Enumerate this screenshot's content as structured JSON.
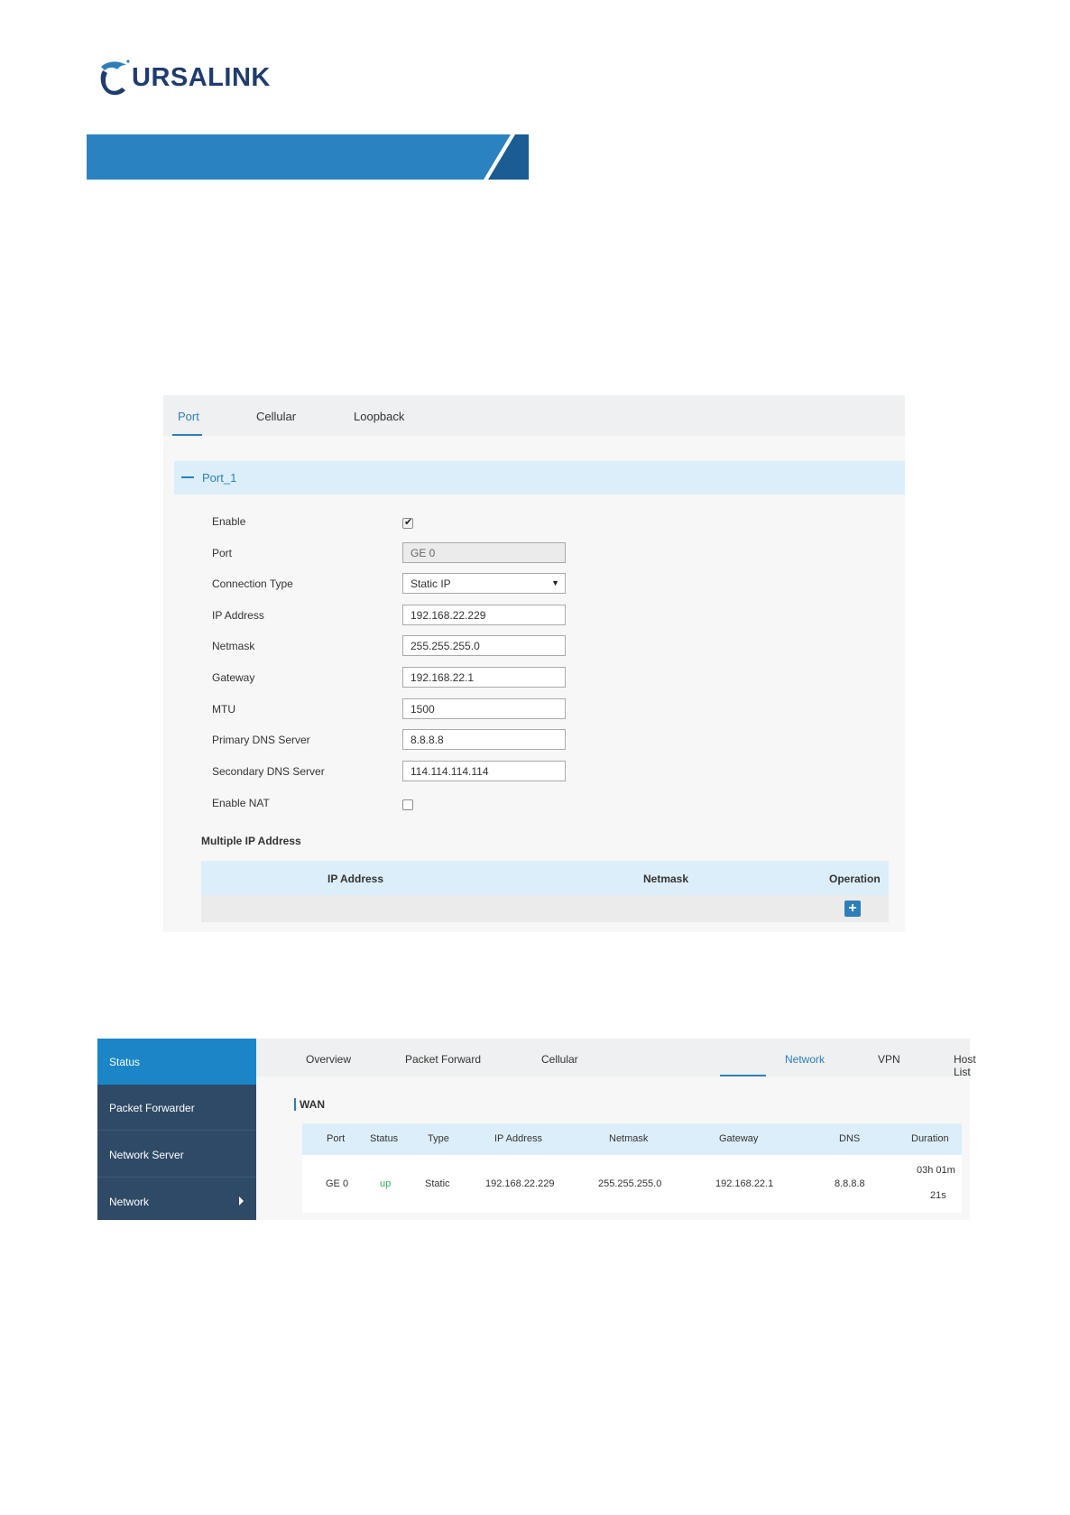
{
  "logo": {
    "text": "URSALINK"
  },
  "colors": {
    "brand": "#2d7fb9",
    "sidebar": "#2e4a66",
    "sidebar_active": "#1a86c8",
    "header_band": "#dceef9",
    "status_up": "#2fa84f"
  },
  "port_config": {
    "tabs": [
      "Port",
      "Cellular",
      "Loopback"
    ],
    "active_tab": "Port",
    "section_title": "Port_1",
    "fields": {
      "enable": {
        "label": "Enable",
        "checked": true
      },
      "port": {
        "label": "Port",
        "value": "GE 0"
      },
      "connection_type": {
        "label": "Connection Type",
        "value": "Static IP"
      },
      "ip_address": {
        "label": "IP Address",
        "value": "192.168.22.229"
      },
      "netmask": {
        "label": "Netmask",
        "value": "255.255.255.0"
      },
      "gateway": {
        "label": "Gateway",
        "value": "192.168.22.1"
      },
      "mtu": {
        "label": "MTU",
        "value": "1500"
      },
      "primary_dns": {
        "label": "Primary DNS Server",
        "value": "8.8.8.8"
      },
      "secondary_dns": {
        "label": "Secondary DNS Server",
        "value": "114.114.114.114"
      },
      "enable_nat": {
        "label": "Enable NAT",
        "checked": false
      }
    },
    "multiple_ip": {
      "title": "Multiple IP Address",
      "columns": [
        "IP Address",
        "Netmask",
        "Operation"
      ],
      "add_icon": "plus-icon"
    }
  },
  "status_page": {
    "sidebar": [
      {
        "label": "Status",
        "active": true
      },
      {
        "label": "Packet Forwarder"
      },
      {
        "label": "Network Server"
      },
      {
        "label": "Network",
        "has_submenu": true
      }
    ],
    "tabs": [
      "Overview",
      "Packet Forward",
      "Cellular",
      "Network",
      "VPN",
      "Host List"
    ],
    "active_tab": "Network",
    "wan": {
      "title": "WAN",
      "columns": [
        "Port",
        "Status",
        "Type",
        "IP Address",
        "Netmask",
        "Gateway",
        "DNS",
        "Duration"
      ],
      "row": {
        "port": "GE 0",
        "status": "up",
        "type": "Static",
        "ip_address": "192.168.22.229",
        "netmask": "255.255.255.0",
        "gateway": "192.168.22.1",
        "dns": "8.8.8.8",
        "duration_line1": "03h 01m",
        "duration_line2": "21s"
      }
    }
  }
}
